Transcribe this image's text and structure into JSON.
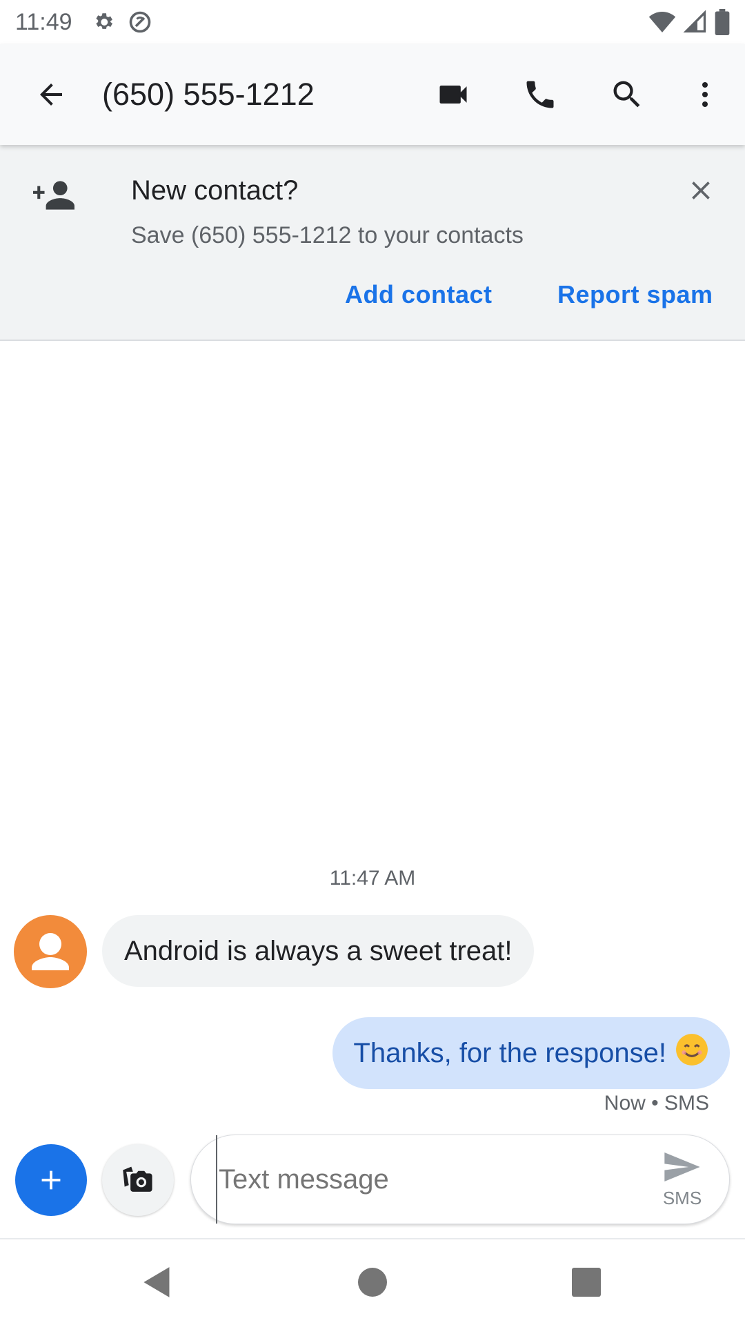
{
  "status_bar": {
    "time": "11:49",
    "icons": [
      "gear-icon",
      "do-not-disturb-icon",
      "wifi-icon",
      "signal-icon",
      "battery-icon"
    ]
  },
  "toolbar": {
    "title": "(650) 555-1212",
    "actions": [
      "back-arrow-icon",
      "video-call-icon",
      "phone-icon",
      "search-icon",
      "more-vert-icon"
    ]
  },
  "banner": {
    "title": "New contact?",
    "subtitle": "Save (650) 555-1212 to your contacts",
    "add_contact_label": "Add contact",
    "report_spam_label": "Report spam"
  },
  "conversation": {
    "timestamp": "11:47 AM",
    "messages": [
      {
        "direction": "incoming",
        "text": "Android is always a sweet treat!"
      },
      {
        "direction": "outgoing",
        "text": "Thanks, for the response!",
        "emoji": "😊"
      }
    ],
    "last_meta": "Now • SMS"
  },
  "compose": {
    "placeholder": "Text message",
    "send_label": "SMS"
  },
  "colors": {
    "accent": "#1a73e8",
    "avatar": "#f28b3b",
    "outgoing_bubble": "#d2e3fc",
    "incoming_bubble": "#f1f3f4"
  }
}
